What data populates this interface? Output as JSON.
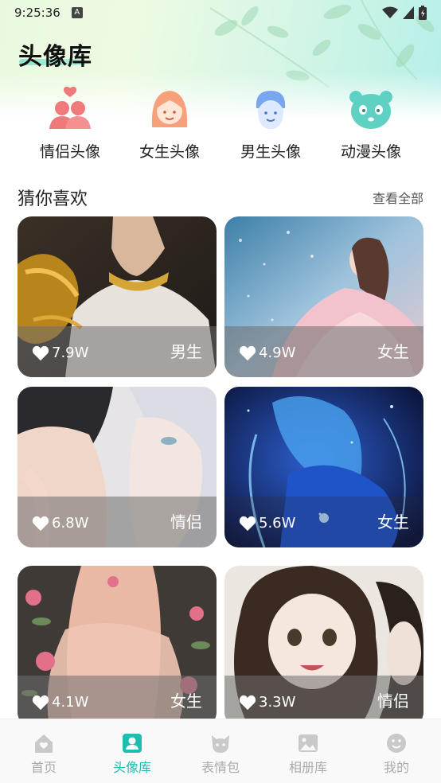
{
  "status_bar": {
    "time": "9:25:36",
    "notification_glyph": "A"
  },
  "page": {
    "title": "头像库"
  },
  "categories": [
    {
      "label": "情侣头像",
      "icon": "couple-icon",
      "color": "#f07a7a"
    },
    {
      "label": "女生头像",
      "icon": "girl-icon",
      "color": "#f8a07a"
    },
    {
      "label": "男生头像",
      "icon": "boy-icon",
      "color": "#7aa6f0"
    },
    {
      "label": "动漫头像",
      "icon": "panda-icon",
      "color": "#5fd1c2"
    }
  ],
  "section": {
    "title": "猜你喜欢",
    "view_all": "查看全部"
  },
  "cards": [
    {
      "likes": "7.9W",
      "tag": "男生"
    },
    {
      "likes": "4.9W",
      "tag": "女生"
    },
    {
      "likes": "6.8W",
      "tag": "情侣"
    },
    {
      "likes": "5.6W",
      "tag": "女生"
    },
    {
      "likes": "4.1W",
      "tag": "女生"
    },
    {
      "likes": "3.3W",
      "tag": "情侣"
    }
  ],
  "tabs": [
    {
      "label": "首页",
      "icon": "home-icon",
      "active": false
    },
    {
      "label": "头像库",
      "icon": "avatar-icon",
      "active": true
    },
    {
      "label": "表情包",
      "icon": "emoji-cat-icon",
      "active": false
    },
    {
      "label": "相册库",
      "icon": "album-icon",
      "active": false
    },
    {
      "label": "我的",
      "icon": "smile-icon",
      "active": false
    }
  ],
  "colors": {
    "accent": "#1fbcb0",
    "inactive": "#aaaaaa"
  }
}
